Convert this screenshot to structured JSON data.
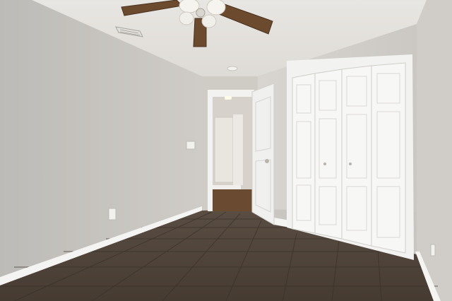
{
  "scene": {
    "subject": "empty-bedroom",
    "features": [
      "ceiling-fan",
      "air-vent",
      "bifold-closet-doors",
      "open-door",
      "hallway",
      "tile-floor",
      "light-switch",
      "power-outlet"
    ]
  },
  "colors": {
    "wall_left": "#c4c2be",
    "wall_right": "#d3d0cb",
    "ceiling": "#e4e2de",
    "floor": "#4e4339",
    "trim": "#f4f4f2",
    "fan_blade": "#6b4a2e",
    "hall_floor": "#6a4a30"
  }
}
